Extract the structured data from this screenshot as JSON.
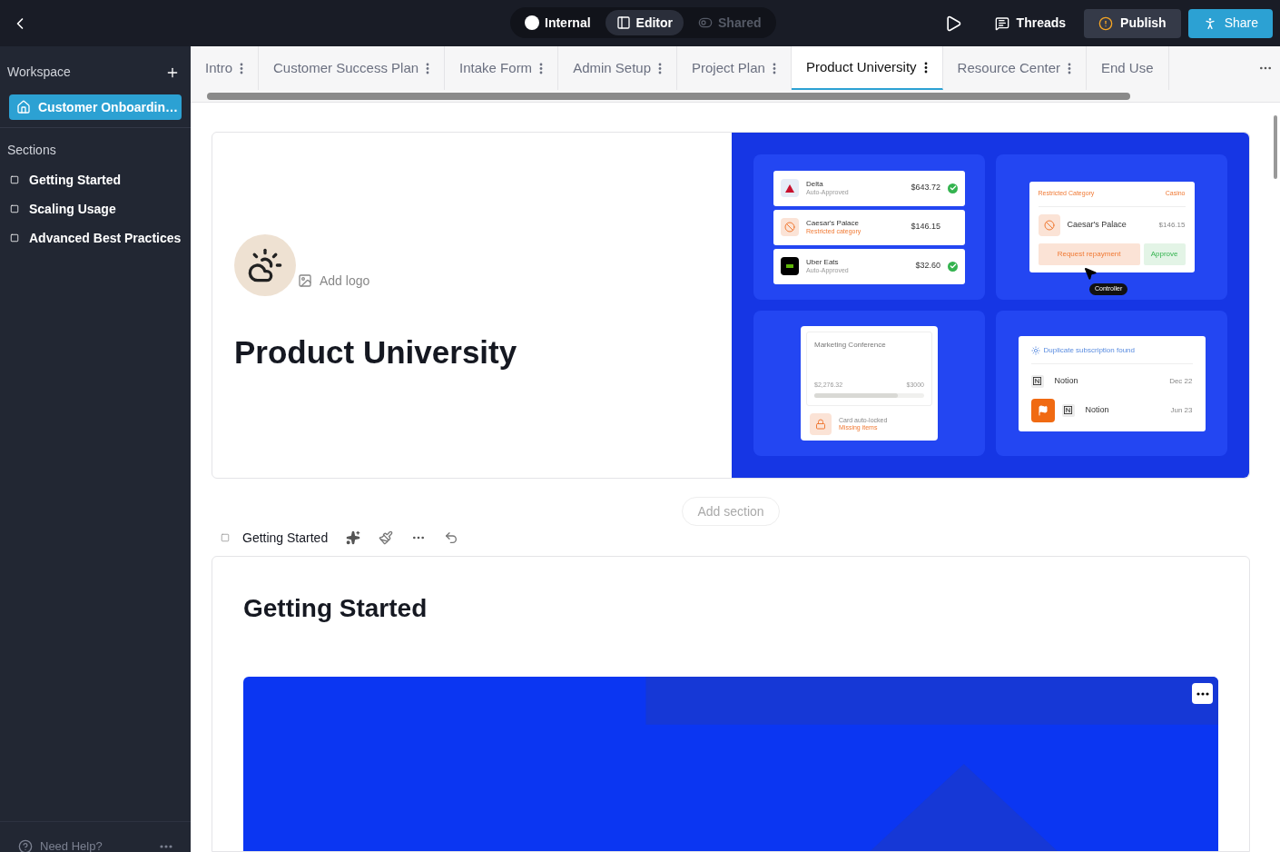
{
  "topbar": {
    "modes": [
      {
        "label": "Internal",
        "kind": "dot",
        "selected": false,
        "disabled": false
      },
      {
        "label": "Editor",
        "kind": "panel",
        "selected": true,
        "disabled": false
      },
      {
        "label": "Shared",
        "kind": "toggle",
        "selected": false,
        "disabled": true
      }
    ],
    "threads": "Threads",
    "publish": "Publish",
    "share": "Share"
  },
  "sidebar": {
    "workspace_label": "Workspace",
    "workspace": "Customer Onboardin…",
    "sections_label": "Sections",
    "sections": [
      "Getting Started",
      "Scaling Usage",
      "Advanced Best Practices"
    ],
    "help": "Need Help?"
  },
  "tabs": [
    {
      "label": "Intro",
      "selected": false
    },
    {
      "label": "Customer Success Plan",
      "selected": false
    },
    {
      "label": "Intake Form",
      "selected": false
    },
    {
      "label": "Admin Setup",
      "selected": false
    },
    {
      "label": "Project Plan",
      "selected": false
    },
    {
      "label": "Product University",
      "selected": true
    },
    {
      "label": "Resource Center",
      "selected": false
    },
    {
      "label": "End Use",
      "selected": false
    }
  ],
  "hero": {
    "add_logo": "Add logo",
    "title": "Product University",
    "mockup": {
      "transactions": [
        {
          "merchant": "Delta",
          "status_text": "Auto-Approved",
          "amount": "$643.72",
          "kind": "approved"
        },
        {
          "merchant": "Caesar's Palace",
          "status_text": "Restricted category",
          "amount": "$146.15",
          "kind": "restricted"
        },
        {
          "merchant": "Uber Eats",
          "status_text": "Auto-Approved",
          "amount": "$32.60",
          "kind": "approved"
        }
      ],
      "review": {
        "label": "Restricted Category",
        "category": "Casino",
        "merchant": "Caesar's Palace",
        "amount": "$146.15",
        "reject": "Request repayment",
        "approve": "Approve",
        "cursor_tag": "Controller"
      },
      "budget": {
        "title": "Marketing Conference",
        "spent": "$2,276.32",
        "limit": "$3000",
        "level": 0.76,
        "alert": "Card auto-locked",
        "alert_reason": "Missing items"
      },
      "duplicate": {
        "title": "Duplicate subscription found",
        "rows": [
          {
            "name": "Notion",
            "date": "Dec 22",
            "flagged": false
          },
          {
            "name": "Notion",
            "date": "Jun 23",
            "flagged": true
          }
        ]
      }
    }
  },
  "add_section": "Add section",
  "section": {
    "toolbar_title": "Getting Started",
    "heading": "Getting Started"
  }
}
